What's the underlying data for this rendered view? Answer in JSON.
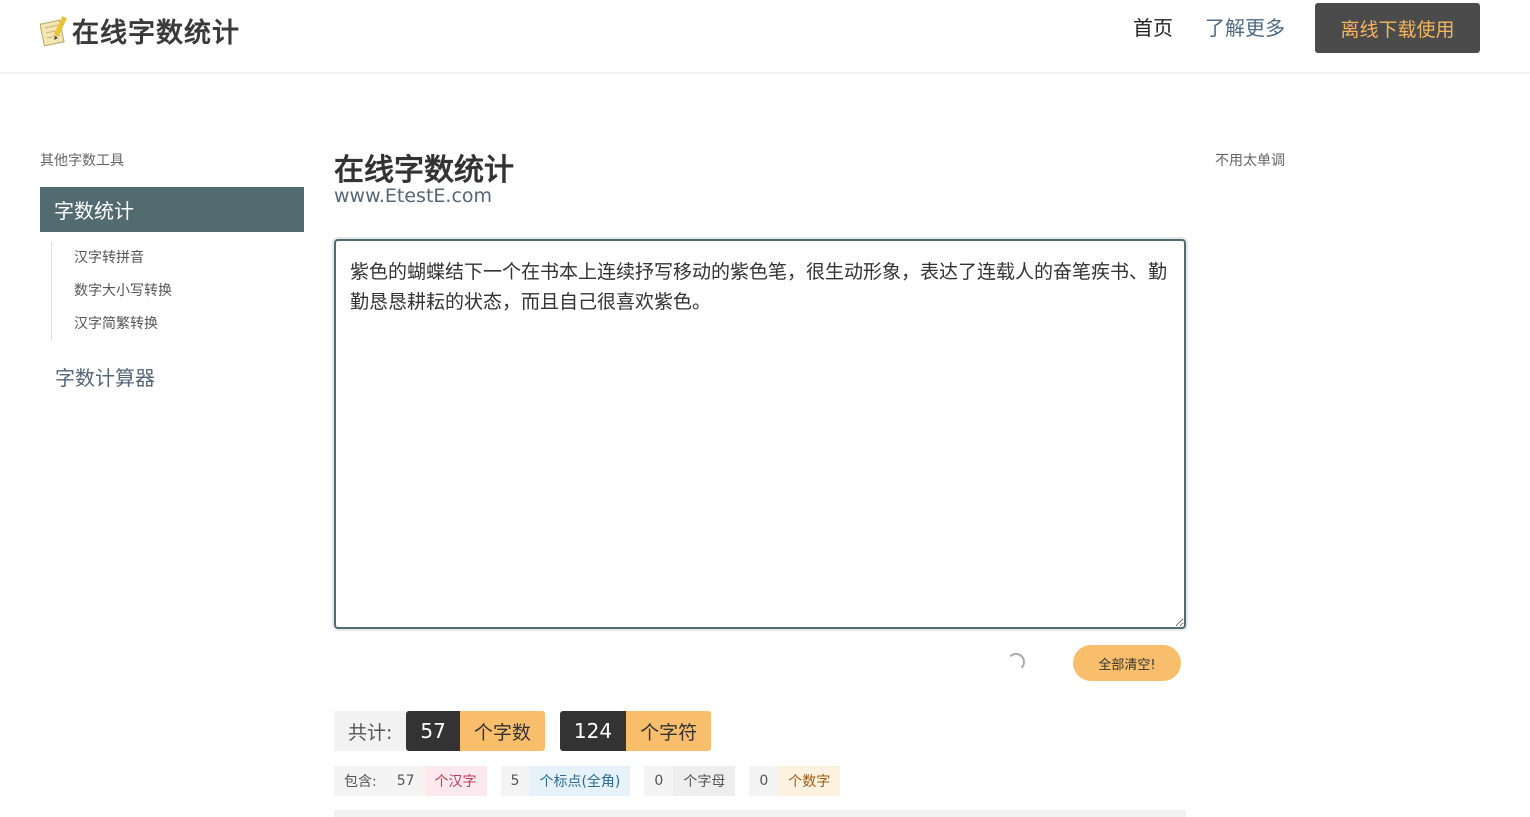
{
  "header": {
    "logo_text": "在线字数统计",
    "nav_home": "首页",
    "nav_more": "了解更多",
    "nav_download": "离线下载使用"
  },
  "sidebar": {
    "title": "其他字数工具",
    "active_item": "字数统计",
    "sub_items": [
      "汉字转拼音",
      "数字大小写转换",
      "汉字简繁转换"
    ],
    "calculator": "字数计算器"
  },
  "right": {
    "note": "不用太单调"
  },
  "main": {
    "title": "在线字数统计",
    "subtitle": "www.EtestE.com",
    "text": "紫色的蝴蝶结下一个在书本上连续抒写移动的紫色笔，很生动形象，表达了连载人的奋笔疾书、勤勤恳恳耕耘的状态，而且自己很喜欢紫色。",
    "clear_button": "全部清空!"
  },
  "stats": {
    "total_label": "共计:",
    "char_count": "57",
    "char_count_unit": "个字数",
    "symbol_count": "124",
    "symbol_count_unit": "个字符"
  },
  "contains": {
    "label": "包含:",
    "hanzi_count": "57",
    "hanzi_unit": "个汉字",
    "punct_count": "5",
    "punct_unit": "个标点(全角)",
    "letter_count": "0",
    "letter_unit": "个字母",
    "digit_count": "0",
    "digit_unit": "个数字"
  },
  "colors": {
    "accent": "#526b70",
    "download_bg": "#4b4b4b",
    "download_text": "#f6b45f",
    "orange": "#f9be6c"
  }
}
